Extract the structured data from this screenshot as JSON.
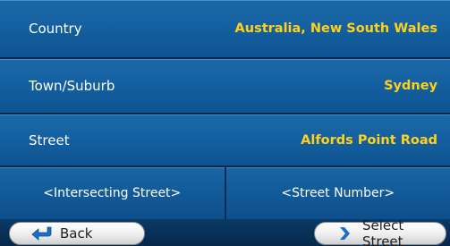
{
  "form": {
    "country": {
      "label": "Country",
      "value": "Australia, New South Wales"
    },
    "town": {
      "label": "Town/Suburb",
      "value": "Sydney"
    },
    "street": {
      "label": "Street",
      "value": "Alfords Point Road"
    },
    "intersecting_label": "<Intersecting Street>",
    "street_number_label": "<Street Number>"
  },
  "buttons": {
    "back_label": "Back",
    "select_label": "Select Street"
  },
  "icons": {
    "back": "back-arrow-icon",
    "select": "chevron-right-icon"
  },
  "colors": {
    "value_text": "#ffd21a",
    "row_blue": "#1560a0",
    "icon_blue": "#1c6fc4"
  }
}
